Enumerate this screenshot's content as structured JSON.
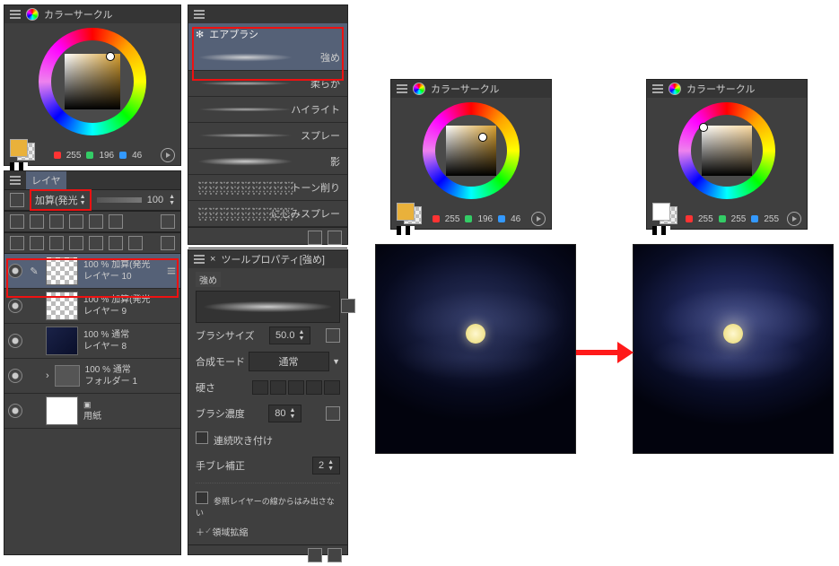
{
  "color_circle": {
    "title": "カラーサークル",
    "rgb1": {
      "r": "255",
      "g": "196",
      "b": "46",
      "swatch_front": "#e9b13b"
    },
    "rgb2": {
      "r": "255",
      "g": "196",
      "b": "46",
      "swatch_front": "#e9b13b"
    },
    "rgb3": {
      "r": "255",
      "g": "255",
      "b": "255",
      "swatch_front": "#ffffff"
    }
  },
  "brushes": {
    "category": "エアブラシ",
    "items": [
      "強め",
      "柔らか",
      "ハイライト",
      "スプレー",
      "影",
      "トーン削り",
      "にじみスプレー"
    ]
  },
  "layers": {
    "tab": "レイヤ",
    "blend": "加算(発光",
    "opacity": "100",
    "rows": [
      {
        "pct": "100 %",
        "mode": "加算(発光",
        "name": "レイヤー 10"
      },
      {
        "pct": "100 %",
        "mode": "加算(発光",
        "name": "レイヤー 9"
      },
      {
        "pct": "100 %",
        "mode": "通常",
        "name": "レイヤー 8"
      },
      {
        "pct": "100 %",
        "mode": "通常",
        "name": "フォルダー 1"
      },
      {
        "pct": "",
        "mode": "",
        "name": "用紙"
      }
    ]
  },
  "toolprop": {
    "title": "ツールプロパティ[強め]",
    "sub": "強め",
    "brush_size_label": "ブラシサイズ",
    "brush_size": "50.0",
    "blend_label": "合成モード",
    "blend": "通常",
    "hard_label": "硬さ",
    "density_label": "ブラシ濃度",
    "density": "80",
    "spray_label": "連続吹き付け",
    "stab_label": "手ブレ補正",
    "stab": "2",
    "ref_label": "参照レイヤーの線からはみ出さない",
    "area_label": "領域拡縮"
  }
}
